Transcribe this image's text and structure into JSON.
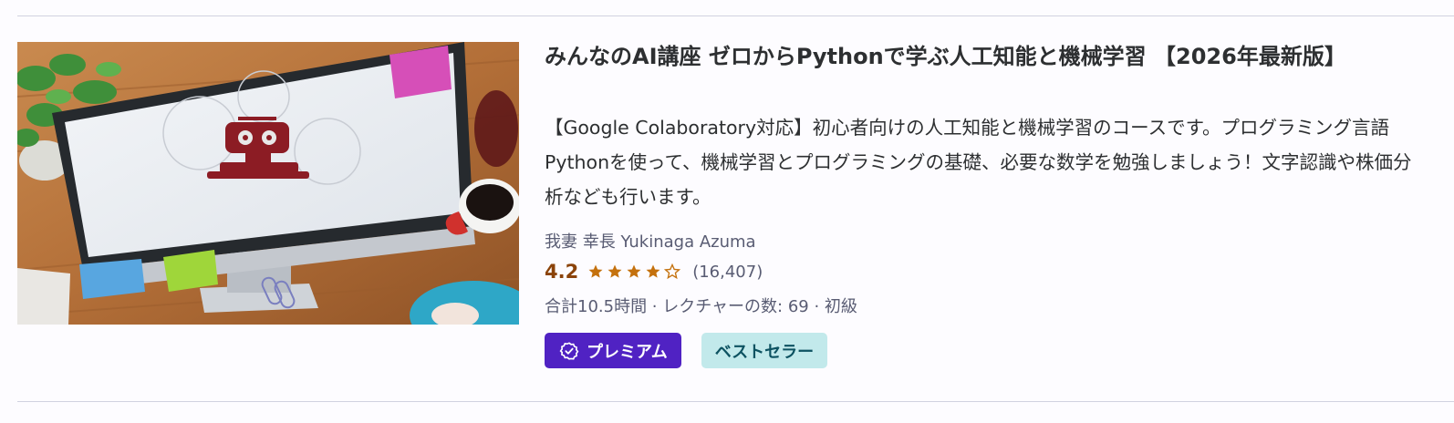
{
  "course": {
    "title": "みんなのAI講座 ゼロからPythonで学ぶ人工知能と機械学習 【2026年最新版】",
    "description": "【Google Colaboratory対応】初心者向けの人工知能と機械学習のコースです。プログラミング言語Pythonを使って、機械学習とプログラミングの基礎、必要な数学を勉強しましょう！文字認識や株価分析なども行います。",
    "instructor": "我妻 幸長 Yukinaga Azuma",
    "rating": "4.2",
    "rating_value": 4.2,
    "stars": [
      "star-filled",
      "star-filled",
      "star-filled",
      "star-filled",
      "star-half"
    ],
    "rating_count": "(16,407)",
    "meta": "合計10.5時間 · レクチャーの数: 69 · 初級",
    "badges": {
      "premium": "プレミアム",
      "bestseller": "ベストセラー"
    },
    "thumbnail_icon": "robot-on-monitor-image"
  },
  "colors": {
    "rating": "#8b4309",
    "star": "#c4710d",
    "premium_bg": "#5022c3",
    "bestseller_bg": "#c2e9eb",
    "bestseller_text": "#0d5261"
  }
}
